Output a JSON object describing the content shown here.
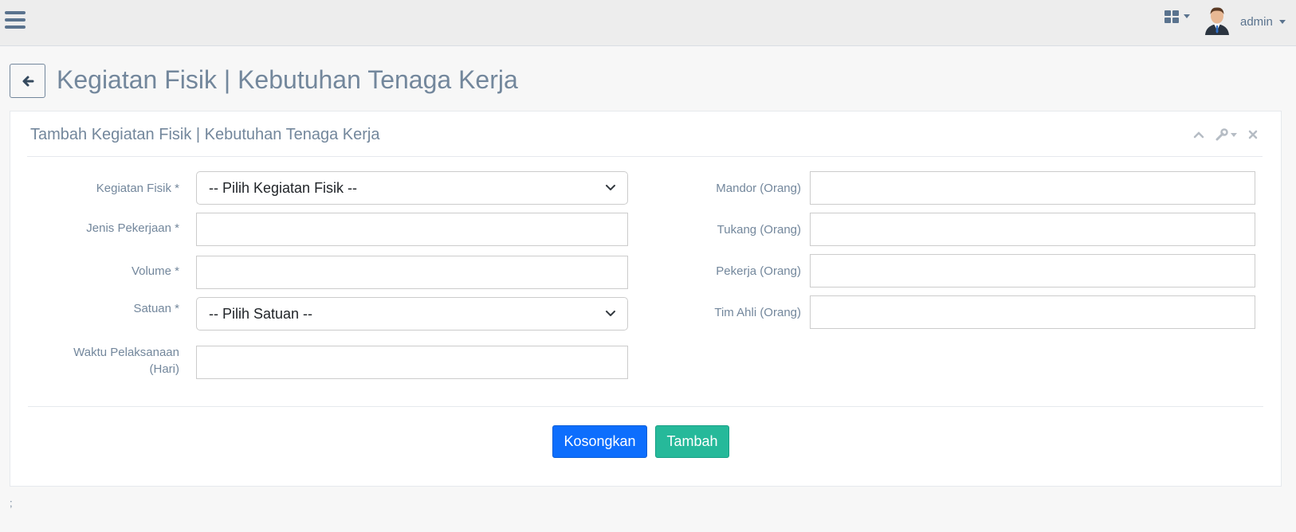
{
  "topbar": {
    "menu_icon": "hamburger-icon",
    "apps_icon": "grid-icon",
    "username": "admin"
  },
  "page": {
    "title": "Kegiatan Fisik | Kebutuhan Tenaga Kerja",
    "back_icon": "arrow-left-icon"
  },
  "panel": {
    "title": "Tambah Kegiatan Fisik | Kebutuhan Tenaga Kerja",
    "tools": [
      "chevron-up-icon",
      "wrench-icon",
      "close-icon"
    ]
  },
  "form": {
    "left": {
      "kegiatan_label": "Kegiatan Fisik *",
      "kegiatan_value": "-- Pilih Kegiatan Fisik --",
      "jenis_label": "Jenis Pekerjaan *",
      "jenis_value": "",
      "volume_label": "Volume *",
      "volume_value": "",
      "satuan_label": "Satuan *",
      "satuan_value": "-- Pilih Satuan --",
      "waktu_label_line1": "Waktu Pelaksanaan",
      "waktu_label_line2": "(Hari)",
      "waktu_value": ""
    },
    "right": {
      "mandor_label": "Mandor (Orang)",
      "mandor_value": "",
      "tukang_label": "Tukang (Orang)",
      "tukang_value": "",
      "pekerja_label": "Pekerja (Orang)",
      "pekerja_value": "",
      "timahli_label": "Tim Ahli (Orang)",
      "timahli_value": ""
    }
  },
  "buttons": {
    "reset_label": "Kosongkan",
    "submit_label": "Tambah"
  },
  "footer": {
    "text": ";"
  },
  "colors": {
    "primary": "#0d6efd",
    "success": "#26b99a",
    "text": "#73879c"
  }
}
